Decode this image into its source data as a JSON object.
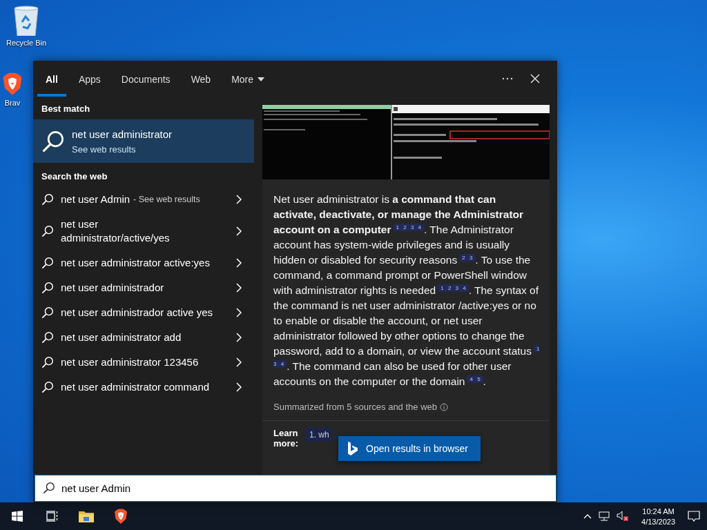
{
  "desktop_icons": [
    {
      "kind": "recycle-bin",
      "label": "Recycle Bin"
    },
    {
      "kind": "brave",
      "label": "Brav"
    }
  ],
  "search_panel": {
    "tabs": [
      {
        "label": "All",
        "selected": true,
        "dropdown": false
      },
      {
        "label": "Apps",
        "selected": false,
        "dropdown": false
      },
      {
        "label": "Documents",
        "selected": false,
        "dropdown": false
      },
      {
        "label": "Web",
        "selected": false,
        "dropdown": false
      },
      {
        "label": "More",
        "selected": false,
        "dropdown": true
      }
    ],
    "best_match": {
      "heading": "Best match",
      "title": "net user administrator",
      "subtitle": "See web results",
      "selected": true
    },
    "web_heading": "Search the web",
    "suggestions": [
      {
        "text": "net user Admin",
        "hint": "- See web results"
      },
      {
        "text": "net user administrator/active/yes"
      },
      {
        "text": "net user administrator active:yes"
      },
      {
        "text": "net user administrador"
      },
      {
        "text": "net user administrador active yes"
      },
      {
        "text": "net user administrator add"
      },
      {
        "text": "net user administrator 123456"
      },
      {
        "text": "net user administrator command"
      }
    ],
    "preview": {
      "summary": "Net user administrator is **a command that can activate, deactivate, or manage the Administrator account on a computer**$^{1 2 3 4}$. The Administrator account has system-wide privileges and is usually hidden or disabled for security reasons$^{2 3}$. To use the command, a command prompt or PowerShell window with administrator rights is needed$^{1 2 3 4}$. The syntax of the command is net user administrator /active:yes or no to enable or disable the account, or net user administrator followed by other options to change the password, add to a domain, or view the account status$^{1 3 4}$. The command can also be used for other user accounts on the computer or the domain$^{4 5}$.",
      "sources": "Summarized from 5 sources and the web",
      "learn_label": "Learn more:",
      "learn_chip": "1. wh",
      "open_button": "Open results in browser"
    }
  },
  "search_box": {
    "value": "net user Admin"
  },
  "taskbar": {
    "apps": [
      {
        "kind": "start"
      },
      {
        "kind": "task-view"
      },
      {
        "kind": "file-explorer"
      },
      {
        "kind": "brave"
      }
    ],
    "time": "10:24 AM",
    "date": "4/13/2023"
  }
}
